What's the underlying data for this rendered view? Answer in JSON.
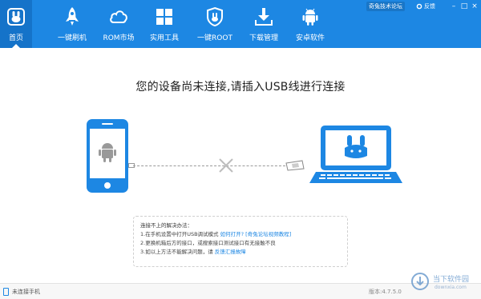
{
  "nav": [
    {
      "label": "首页",
      "icon": "rabbit-home-icon",
      "active": true
    },
    {
      "label": "一键刷机",
      "icon": "rocket-icon"
    },
    {
      "label": "ROM市场",
      "icon": "cloud-icon"
    },
    {
      "label": "实用工具",
      "icon": "grid-icon"
    },
    {
      "label": "一键ROOT",
      "icon": "shield-icon"
    },
    {
      "label": "下载管理",
      "icon": "download-icon"
    },
    {
      "label": "安卓软件",
      "icon": "android-icon"
    }
  ],
  "system": {
    "forum": "奇兔技术论坛",
    "feedback": "反馈",
    "minimize": "–",
    "maximize": "□",
    "close": "×"
  },
  "main": {
    "headline": "您的设备尚未连接,请插入USB线进行连接"
  },
  "tips": {
    "title": "连接不上的解决办法：",
    "line1": "1.在手机设置中打开USB调试模式",
    "line1_link1": "如何打开?",
    "line1_link2": "[奇兔论坛视频教程]",
    "line2": "2.更换机箱后方的接口，或搜索接口测试接口有无接触不良",
    "line3": "3.如以上方法不能解决问题，请",
    "line3_link": "反馈汇报故障"
  },
  "status": {
    "connection": "未连接手机",
    "version": "版本:4.7.5.0"
  },
  "watermark": {
    "text": "当下软件园",
    "sub": "downxia.com"
  },
  "colors": {
    "brand": "#1d87e3",
    "active": "#1573c9"
  }
}
